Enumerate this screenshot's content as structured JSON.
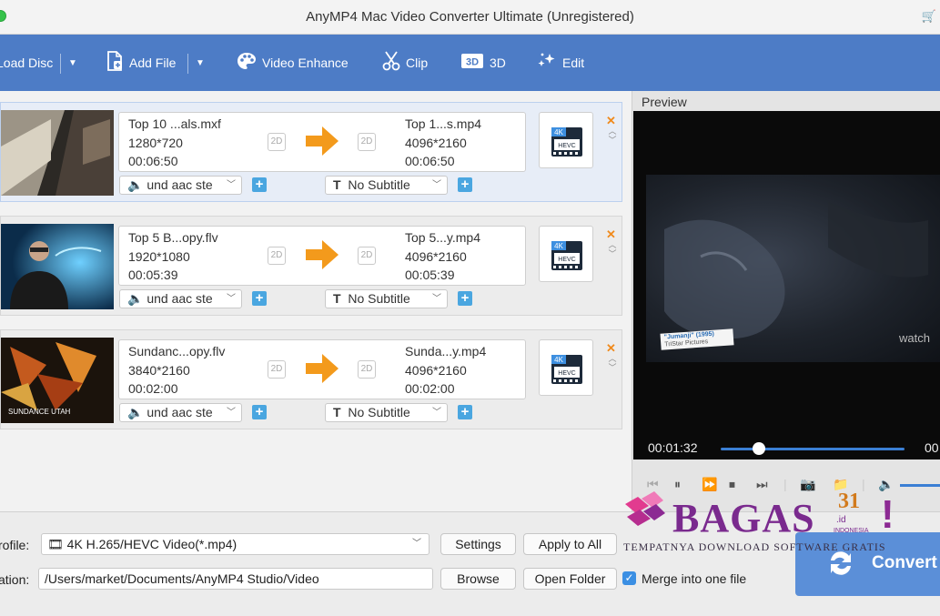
{
  "window": {
    "title": "AnyMP4 Mac Video Converter Ultimate (Unregistered)"
  },
  "toolbar": {
    "load_disc": "Load Disc",
    "add_file": "Add File",
    "video_enhance": "Video Enhance",
    "clip": "Clip",
    "three_d": "3D",
    "edit": "Edit"
  },
  "files": [
    {
      "src_name": "Top 10 ...als.mxf",
      "src_res": "1280*720",
      "src_dur": "00:06:50",
      "dst_name": "Top 1...s.mp4",
      "dst_res": "4096*2160",
      "dst_dur": "00:06:50",
      "audio": "und aac ste",
      "subtitle": "No Subtitle"
    },
    {
      "src_name": "Top 5 B...opy.flv",
      "src_res": "1920*1080",
      "src_dur": "00:05:39",
      "dst_name": "Top 5...y.mp4",
      "dst_res": "4096*2160",
      "dst_dur": "00:05:39",
      "audio": "und aac ste",
      "subtitle": "No Subtitle"
    },
    {
      "src_name": "Sundanc...opy.flv",
      "src_res": "3840*2160",
      "src_dur": "00:02:00",
      "dst_name": "Sunda...y.mp4",
      "dst_res": "4096*2160",
      "dst_dur": "00:02:00",
      "audio": "und aac ste",
      "subtitle": "No Subtitle"
    }
  ],
  "badges": {
    "two_d": "2D",
    "format_top": "4K",
    "format_bottom": "HEVC"
  },
  "preview": {
    "label": "Preview",
    "current_time": "00:01:32",
    "end_time": "00",
    "progress": 0.21,
    "caption_title": "\"Jumanji\" (1995)",
    "caption_sub": "TriStar Pictures",
    "watch_text": "watch"
  },
  "profile": {
    "label": "rofile:",
    "value": "4K H.265/HEVC Video(*.mp4)",
    "settings": "Settings",
    "apply_all": "Apply to All"
  },
  "destination": {
    "label": "ation:",
    "path": "/Users/market/Documents/AnyMP4 Studio/Video",
    "browse": "Browse",
    "open_folder": "Open Folder",
    "merge": "Merge into one file"
  },
  "convert_label": "Convert",
  "watermark": {
    "brand": "BAGAS",
    "number": "31",
    "suffix": ".id",
    "country": "INDONESIA",
    "tagline": "TEMPATNYA DOWNLOAD SOFTWARE GRATIS"
  },
  "colors": {
    "accent": "#4d7cc6",
    "arrow": "#f39a1c",
    "plus": "#4aa6e0",
    "convert": "#5b8fd8",
    "watermark": "#7a2a8e"
  }
}
